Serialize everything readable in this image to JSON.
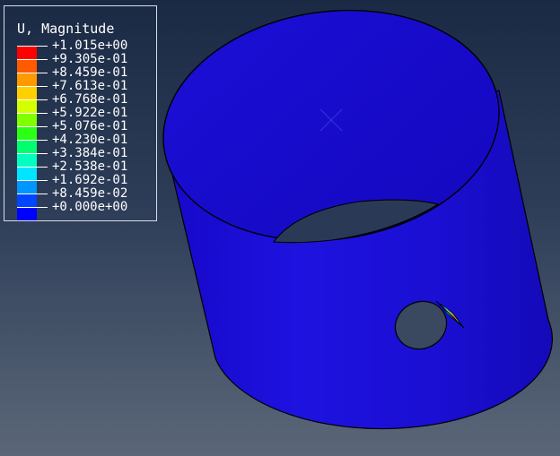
{
  "legend": {
    "title": "U, Magnitude",
    "entries": [
      {
        "label": "+1.015e+00",
        "color": "#ff0000"
      },
      {
        "label": "+9.305e-01",
        "color": "#ff5a00"
      },
      {
        "label": "+8.459e-01",
        "color": "#ff9900"
      },
      {
        "label": "+7.613e-01",
        "color": "#ffd000"
      },
      {
        "label": "+6.768e-01",
        "color": "#d4ff00"
      },
      {
        "label": "+5.922e-01",
        "color": "#80ff00"
      },
      {
        "label": "+5.076e-01",
        "color": "#2bff14"
      },
      {
        "label": "+4.230e-01",
        "color": "#00ff6e"
      },
      {
        "label": "+3.384e-01",
        "color": "#00ffc0"
      },
      {
        "label": "+2.538e-01",
        "color": "#00e6ff"
      },
      {
        "label": "+1.692e-01",
        "color": "#0096ff"
      },
      {
        "label": "+8.459e-02",
        "color": "#0045ff"
      },
      {
        "label": "+0.000e+00",
        "color": "#0000ff"
      }
    ]
  },
  "model": {
    "body_color": "#1a10d6",
    "outline_color": "#000000",
    "hot_spot_colors": [
      "#ff0000",
      "#ffd000",
      "#00e6ff"
    ]
  }
}
